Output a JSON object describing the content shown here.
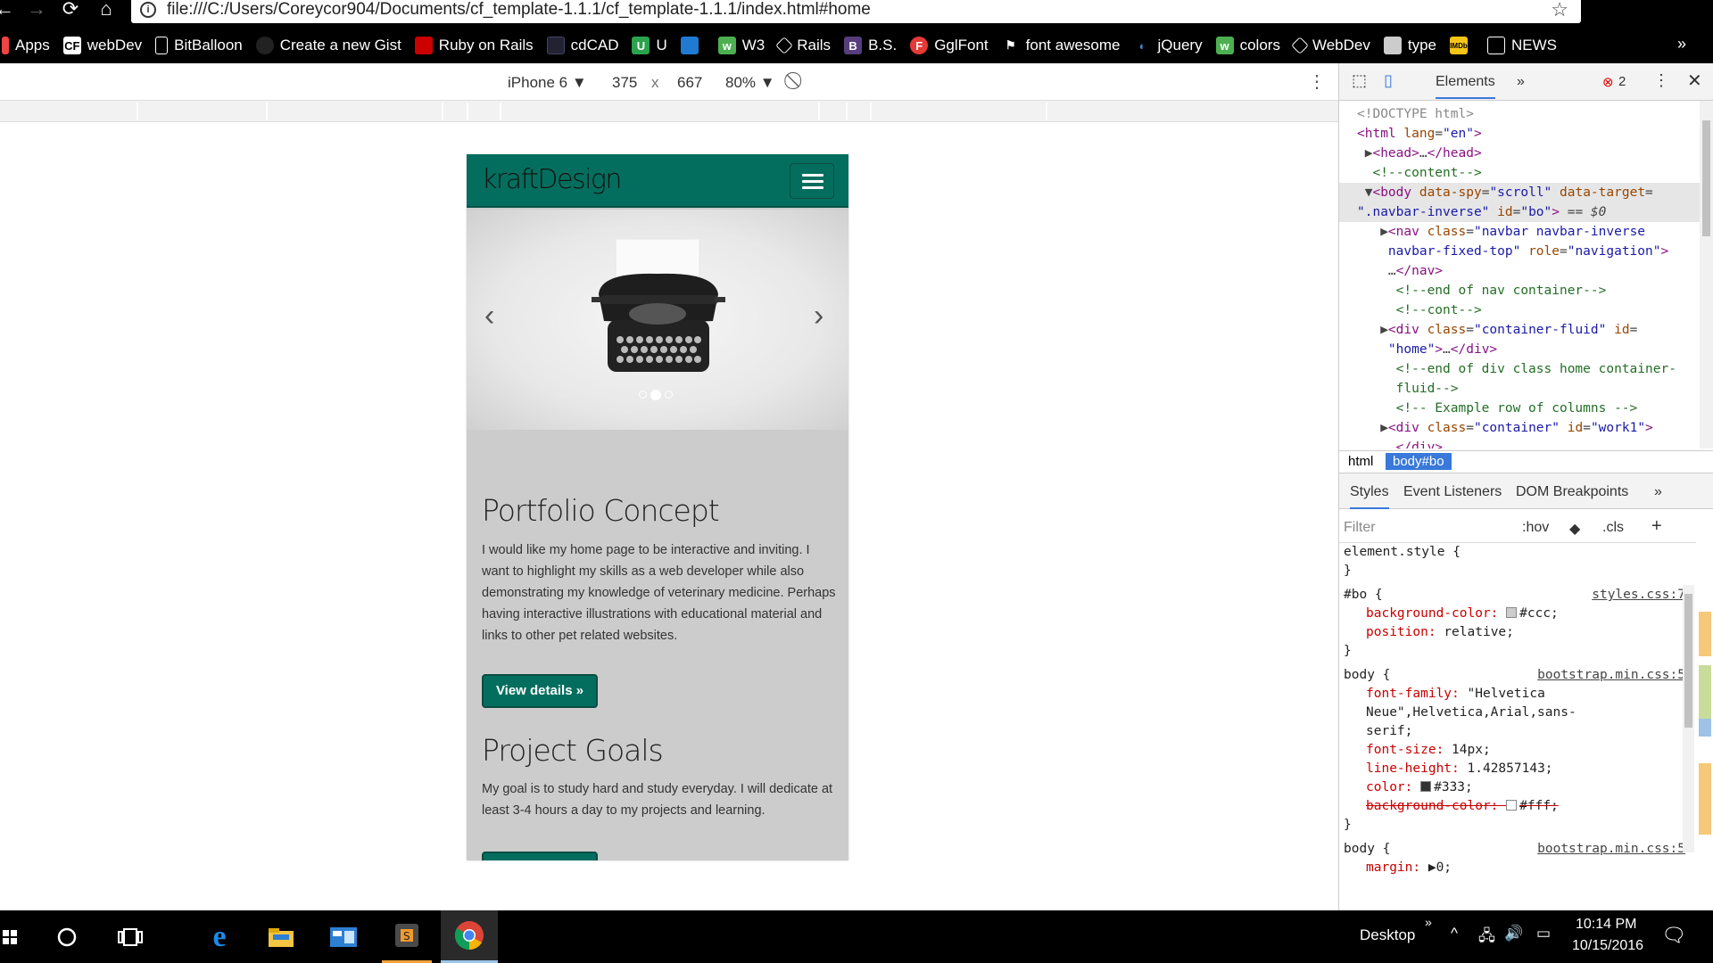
{
  "browser": {
    "url": "file:///C:/Users/Coreycor904/Documents/cf_template-1.1.1/cf_template-1.1.1/index.html#home",
    "bookmarks": [
      "Apps",
      "webDev",
      "BitBalloon",
      "Create a new Gist",
      "Ruby on Rails",
      "cdCAD",
      "U",
      "",
      "W3",
      "Rails",
      "B.S.",
      "GglFont",
      "font awesome",
      "jQuery",
      "colors",
      "WebDev",
      "type",
      "",
      "NEWS"
    ],
    "bookmark_more": "»"
  },
  "device_toolbar": {
    "device": "iPhone 6",
    "width": "375",
    "times": "x",
    "height": "667",
    "zoom": "80%"
  },
  "page": {
    "brand": "kraftDesign",
    "sections": [
      {
        "title": "Portfolio Concept",
        "text": "I would like my home page to be interactive and inviting. I want to highlight my skills as a web developer while also demonstrating my knowledge of veterinary medicine. Perhaps having interactive illustrations with educational material and links to other pet related websites.",
        "button": "View details »"
      },
      {
        "title": "Project Goals",
        "text": "My goal is to study hard and study everyday. I will dedicate at least 3-4 hours a day to my projects and learning.",
        "button": ""
      }
    ]
  },
  "devtools": {
    "tab_elements": "Elements",
    "tab_more": "»",
    "error_count": "2",
    "breadcrumb": [
      "html",
      "body#bo"
    ],
    "styles_tabs": [
      "Styles",
      "Event Listeners",
      "DOM Breakpoints",
      "»"
    ],
    "filter_placeholder": "Filter",
    "hov": ":hov",
    "cls": ".cls",
    "plus": "+"
  },
  "taskbar": {
    "desktop_label": "Desktop",
    "time": "10:14 PM",
    "date": "10/15/2016"
  },
  "colors": {
    "navbar": "#046e5e",
    "page_bg": "#cccccc",
    "selection_blue": "#3879d9"
  }
}
